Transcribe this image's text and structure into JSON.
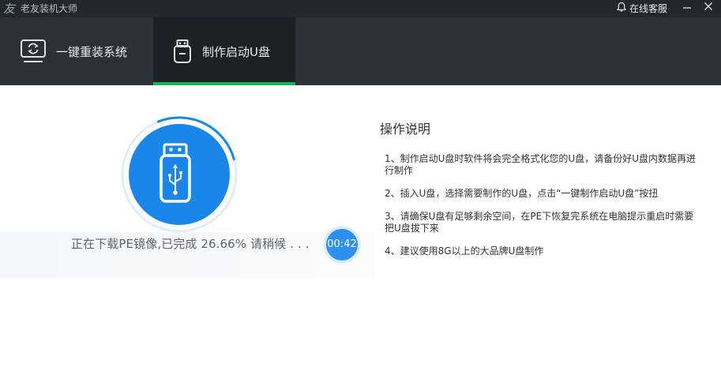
{
  "titlebar": {
    "app_title": "老友装机大师",
    "support_label": "在线客服",
    "icons": {
      "logo": "app-logo-icon",
      "bell": "bell-icon",
      "minimize": "minimize-icon",
      "close": "close-icon"
    }
  },
  "tabs": [
    {
      "label": "一键重装系统",
      "icon": "monitor-refresh-icon",
      "active": false
    },
    {
      "label": "制作启动U盘",
      "icon": "usb-drive-icon",
      "active": true
    }
  ],
  "colors": {
    "accent_green": "#19b35a",
    "accent_blue": "#1a86e8",
    "timer_blue": "#2f8ff0",
    "titlebar_bg": "#23282e",
    "tabbar_bg": "#2b3137"
  },
  "progress": {
    "status_text": "正在下载PE镜像,已完成 26.66% 请稍候 . . .",
    "percent": 26.66,
    "timer": "00:42"
  },
  "instructions": {
    "title": "操作说明",
    "items": [
      "1、制作启动U盘时软件将会完全格式化您的U盘，请备份好U盘内数据再进行制作",
      "2、插入U盘，选择需要制作的U盘，点击“一键制作启动U盘”按扭",
      "3、请确保U盘有足够剩余空间，在PE下恢复完系统在电脑提示重启时需要把U盘拔下来",
      "4、建议使用8G以上的大品牌U盘制作"
    ]
  }
}
